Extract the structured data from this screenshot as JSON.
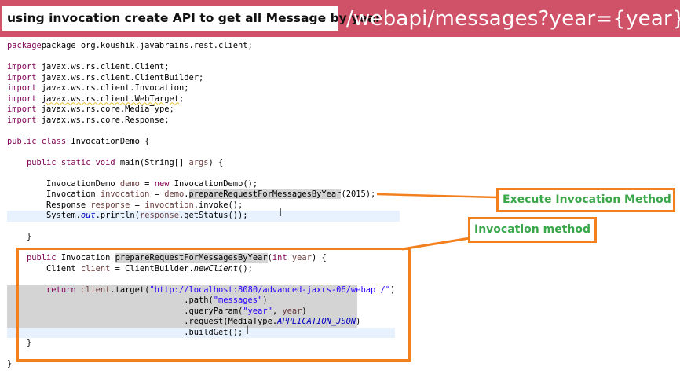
{
  "header": {
    "title": "using invocation create API to get all Message by year",
    "url": "/webapi/messages?year={year}"
  },
  "annotations": {
    "execute": "Execute Invocation Method",
    "invocation": "Invocation method"
  },
  "code": {
    "l1": "package org.koushik.javabrains.rest.client;",
    "import_kw": "import",
    "imp1": " javax.ws.rs.client.Client;",
    "imp2": " javax.ws.rs.client.ClientBuilder;",
    "imp3": " javax.ws.rs.client.Invocation;",
    "imp4_pre": " ",
    "imp4": "javax.ws.rs.client.WebTarget",
    "imp4_post": ";",
    "imp5": " javax.ws.rs.core.MediaType;",
    "imp6": " javax.ws.rs.core.Response;",
    "cls_kw": "public class",
    "cls_name": " InvocationDemo {",
    "main_kw1": "public static void",
    "main_rest": " main(String[] ",
    "main_args": "args",
    "main_end": ") {",
    "d1_type": "InvocationDemo ",
    "d1_var": "demo",
    "d1_eq": " = ",
    "d1_new": "new",
    "d1_end": " InvocationDemo();",
    "d2_type": "Invocation ",
    "d2_var": "invocation",
    "d2_eq": " = ",
    "d2_demo": "demo",
    "d2_dot": ".",
    "d2_method": "prepareRequestForMessagesByYear",
    "d2_end": "(2015);",
    "d3_type": "Response ",
    "d3_var": "response",
    "d3_eq": " = ",
    "d3_inv": "invocation",
    "d3_end": ".invoke();",
    "d4_pre": "System.",
    "d4_out": "out",
    "d4_mid": ".println(",
    "d4_resp": "response",
    "d4_end": ".getStatus());",
    "close1": "}",
    "m2_pub": "public",
    "m2_type": " Invocation ",
    "m2_name": "prepareRequestForMessagesByYear",
    "m2_paren": "(",
    "m2_int": "int",
    "m2_space": " ",
    "m2_year": "year",
    "m2_end": ") {",
    "c1_type": "Client ",
    "c1_var": "client",
    "c1_eq": " = ClientBuilder.",
    "c1_new": "newClient",
    "c1_end": "();",
    "r1_kw": "return",
    "r1_sp": " ",
    "r1_client": "client",
    "r1_mid": ".target(",
    "r1_url": "\"http://localhost:8080/advanced-jaxrs-06/webapi/\"",
    "r1_end": ")",
    "r2_pre": ".path(",
    "r2_str": "\"messages\"",
    "r2_end": ")",
    "r3_pre": ".queryParam(",
    "r3_str": "\"year\"",
    "r3_mid": ", ",
    "r3_year": "year",
    "r3_end": ")",
    "r4_pre": ".request(MediaType.",
    "r4_const": "APPLICATION_JSON",
    "r4_end": ")",
    "r5": ".buildGet();",
    "close2": "}",
    "close3": "}"
  }
}
